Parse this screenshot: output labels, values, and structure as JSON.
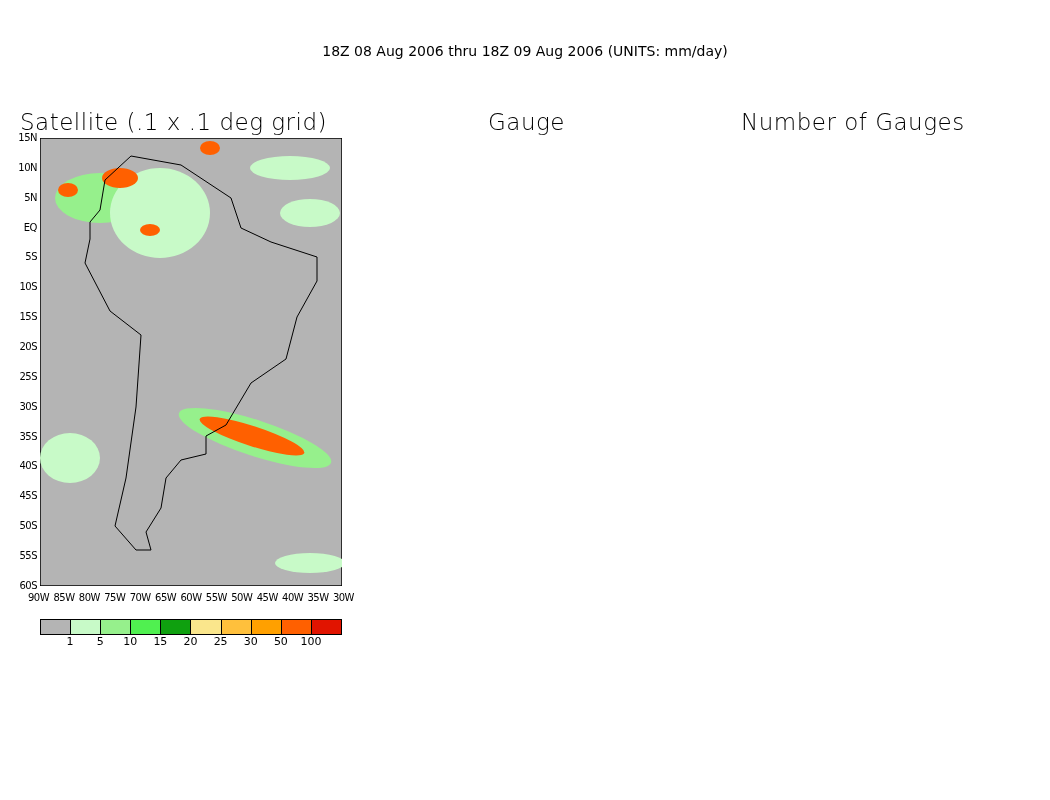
{
  "header": "18Z 08 Aug 2006 thru 18Z 09 Aug 2006 (UNITS: mm/day)",
  "panels": [
    {
      "title": "Satellite (.1 x .1 deg grid)"
    },
    {
      "title": "Gauge"
    },
    {
      "title": "Number of Gauges"
    }
  ],
  "map": {
    "lat_labels": [
      "15N",
      "10N",
      "5N",
      "EQ",
      "5S",
      "10S",
      "15S",
      "20S",
      "25S",
      "30S",
      "35S",
      "40S",
      "45S",
      "50S",
      "55S",
      "60S"
    ],
    "lon_labels": [
      "90W",
      "85W",
      "80W",
      "75W",
      "70W",
      "65W",
      "60W",
      "55W",
      "50W",
      "45W",
      "40W",
      "35W",
      "30W"
    ]
  },
  "colorbar": {
    "bins": [
      {
        "color": "#b4b4b4"
      },
      {
        "color": "#c8fac8"
      },
      {
        "color": "#96f08c"
      },
      {
        "color": "#50f050"
      },
      {
        "color": "#0fa00f"
      },
      {
        "color": "#fae68c"
      },
      {
        "color": "#ffc03c"
      },
      {
        "color": "#ffa000"
      },
      {
        "color": "#ff6000"
      },
      {
        "color": "#e11400"
      }
    ],
    "labels": [
      "1",
      "5",
      "10",
      "15",
      "20",
      "25",
      "30",
      "50",
      "100"
    ]
  }
}
